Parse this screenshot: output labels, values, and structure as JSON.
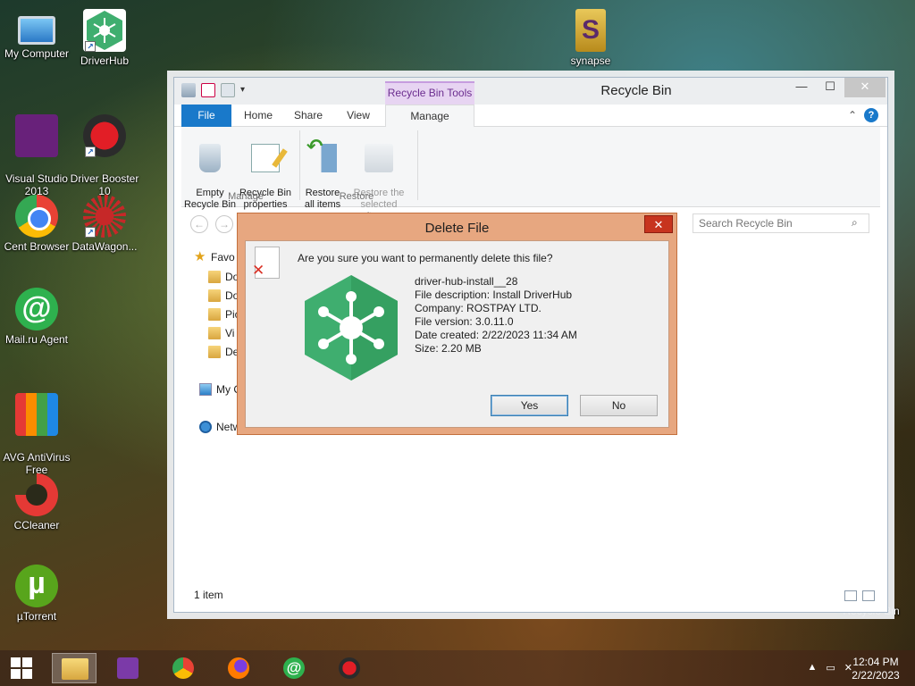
{
  "desktop": {
    "icons": [
      {
        "label": "My Computer",
        "icon": "computer-icon"
      },
      {
        "label": "DriverHub",
        "icon": "driverhub-icon"
      },
      {
        "label": "Visual Studio\n2013",
        "icon": "visual-studio-icon"
      },
      {
        "label": "Driver Booster\n10",
        "icon": "driver-booster-icon"
      },
      {
        "label": "Cent Browser",
        "icon": "cent-browser-icon"
      },
      {
        "label": "DataWagon...",
        "icon": "datawagon-icon"
      },
      {
        "label": "Mail.ru Agent",
        "icon": "mailru-agent-icon"
      },
      {
        "label": "AVG AntiVirus\nFree",
        "icon": "avg-antivirus-icon"
      },
      {
        "label": "CCleaner",
        "icon": "ccleaner-icon"
      },
      {
        "label": "µTorrent",
        "icon": "utorrent-icon"
      },
      {
        "label": "synapse",
        "icon": "synapse-icon"
      },
      {
        "label": "Recycle Bin",
        "icon": "recycle-bin-icon"
      }
    ]
  },
  "explorer": {
    "title": "Recycle Bin",
    "contextual_tab": "Recycle Bin Tools",
    "tabs": {
      "file": "File",
      "home": "Home",
      "share": "Share",
      "view": "View",
      "manage": "Manage"
    },
    "ribbon": {
      "empty": "Empty\nRecycle Bin",
      "properties": "Recycle Bin\nproperties",
      "restore_all": "Restore\nall items",
      "restore_selected": "Restore the\nselected items",
      "group_manage": "Manage",
      "group_restore": "Restore"
    },
    "search_placeholder": "Search Recycle Bin",
    "nav": {
      "favorites": "Favo",
      "item1": "Do",
      "item2": "Do",
      "item3": "Pic",
      "item4": "Vi",
      "item5": "De",
      "computer": "My Computer",
      "network": "Netw"
    },
    "status": "1 item",
    "window_controls": {
      "minimize": "—",
      "maximize": "☐",
      "close": "✕"
    }
  },
  "dialog": {
    "title": "Delete File",
    "close": "✕",
    "question": "Are you sure you want to permanently delete this file?",
    "file": {
      "name": "driver-hub-install__28",
      "description": "File description: Install DriverHub",
      "company": "Company: ROSTPAY LTD.",
      "version": "File version: 3.0.11.0",
      "date": "Date created: 2/22/2023 11:34 AM",
      "size": "Size: 2.20 MB"
    },
    "yes": "Yes",
    "no": "No",
    "colors": {
      "frame": "#e7a780",
      "logo_green": "#3fae6f"
    }
  },
  "taskbar": {
    "time": "12:04 PM",
    "date": "2/22/2023",
    "tray_arrow": "▲",
    "items": [
      "start-icon",
      "file-explorer-icon",
      "visual-studio-icon",
      "cent-browser-icon",
      "firefox-icon",
      "mailru-agent-icon",
      "driver-booster-icon"
    ]
  }
}
